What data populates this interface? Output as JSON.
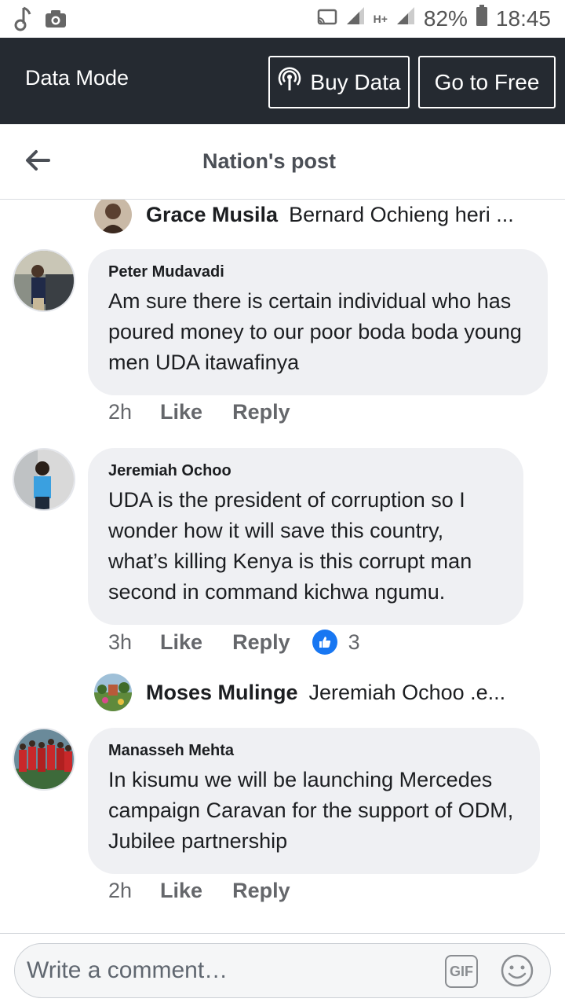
{
  "status_bar": {
    "battery": "82%",
    "time": "18:45",
    "network_type": "H+"
  },
  "data_mode": {
    "title": "Data Mode",
    "buy_label": "Buy Data",
    "free_label": "Go to Free"
  },
  "header": {
    "title": "Nation's post"
  },
  "comments": [
    {
      "type": "reply_preview",
      "name": "Grace Musila",
      "text": "Bernard Ochieng heri ..."
    },
    {
      "type": "comment",
      "author": "Peter Mudavadi",
      "text": "Am sure there is certain individual who has poured money to our poor boda boda young men UDA itawafinya",
      "time": "2h",
      "like": "Like",
      "reply": "Reply"
    },
    {
      "type": "comment",
      "author": "Jeremiah Ochoo",
      "text": "UDA is the president of corruption so I wonder how it will save this country, what’s killing Kenya is this corrupt man second in command kichwa ngumu.",
      "time": "3h",
      "like": "Like",
      "reply": "Reply",
      "reactions": "3"
    },
    {
      "type": "reply_preview",
      "name": "Moses Mulinge",
      "text": "Jeremiah Ochoo .e..."
    },
    {
      "type": "comment",
      "author": "Manasseh Mehta",
      "text": "In kisumu we will be launching Mercedes campaign Caravan for the support of ODM, Jubilee partnership",
      "time": "2h",
      "like": "Like",
      "reply": "Reply"
    }
  ],
  "composer": {
    "placeholder": "Write a comment…",
    "gif_label": "GIF"
  }
}
